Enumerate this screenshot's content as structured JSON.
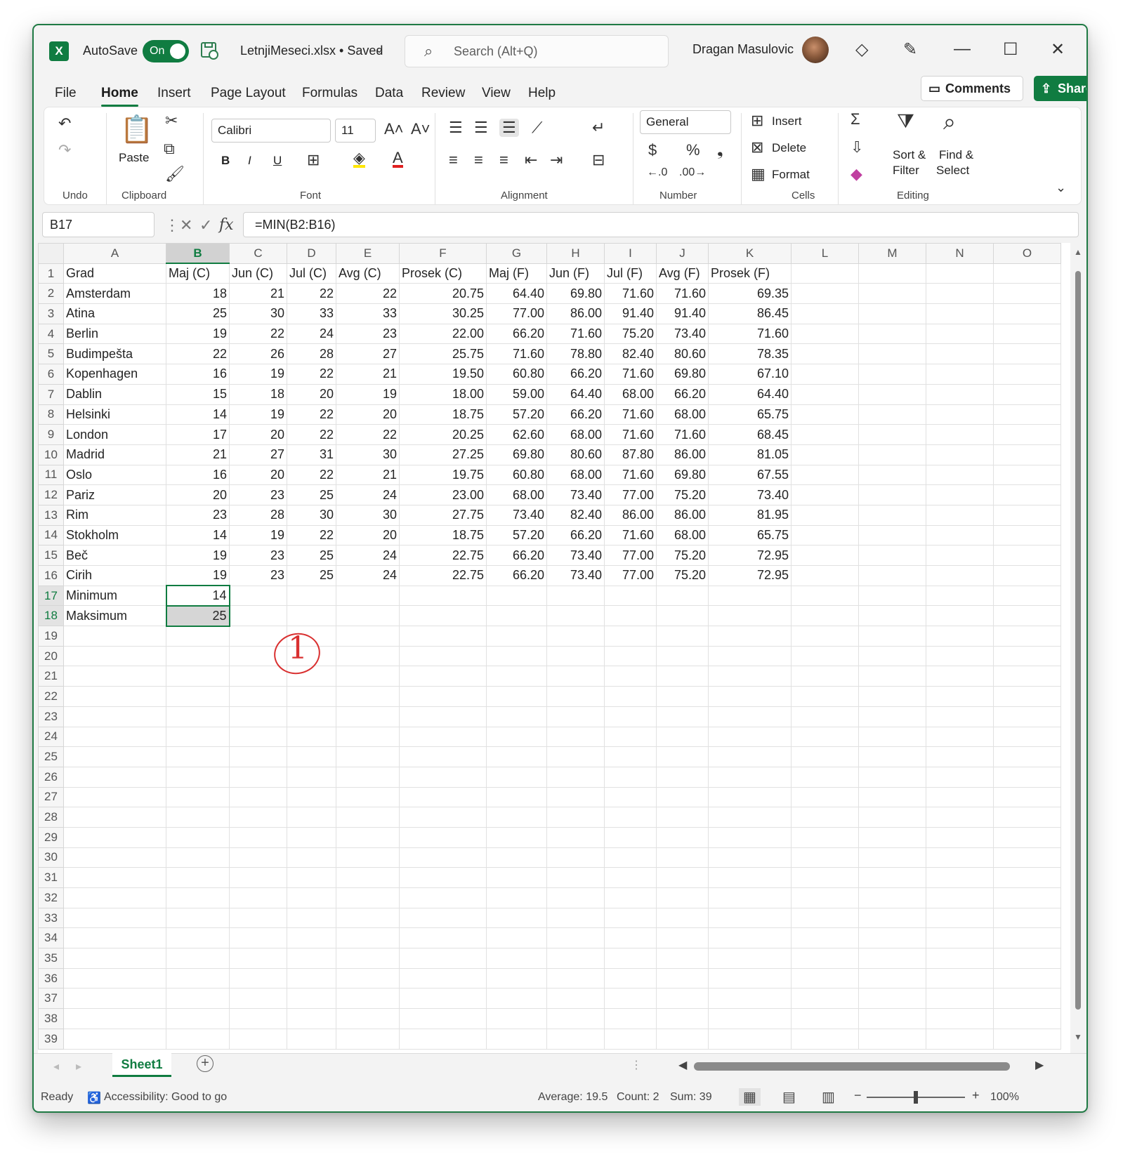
{
  "titlebar": {
    "app_logo": "X",
    "autosave_label": "AutoSave",
    "autosave_state": "On",
    "filename": "LetnjiMeseci.xlsx • Saved",
    "search_placeholder": "Search (Alt+Q)",
    "user_name": "Dragan Masulovic",
    "minimize": "—",
    "maximize": "☐",
    "close": "✕"
  },
  "menu": {
    "tabs": [
      "File",
      "Home",
      "Insert",
      "Page Layout",
      "Formulas",
      "Data",
      "Review",
      "View",
      "Help"
    ],
    "comments_label": "Comments",
    "share_label": "Share"
  },
  "ribbon": {
    "groups": {
      "undo": "Undo",
      "clipboard": "Clipboard",
      "font": "Font",
      "alignment": "Alignment",
      "number": "Number",
      "cells": "Cells",
      "editing": "Editing"
    },
    "paste_label": "Paste",
    "font_name": "Calibri",
    "font_size": "11",
    "bold": "B",
    "italic": "I",
    "underline": "U",
    "number_format": "General",
    "currency": "$",
    "percent": "%",
    "comma": "❟",
    "cells_insert": "Insert",
    "cells_delete": "Delete",
    "cells_format": "Format",
    "sort_filter": [
      "Sort &",
      "Filter"
    ],
    "find_select": [
      "Find &",
      "Select"
    ],
    "accent_colors": {
      "fill": "#ffe600",
      "font": "#e02020"
    }
  },
  "formula_bar": {
    "name_box": "B17",
    "fx": "fx",
    "formula": "=MIN(B2:B16)"
  },
  "sheet": {
    "columns": [
      "A",
      "B",
      "C",
      "D",
      "E",
      "F",
      "G",
      "H",
      "I",
      "J",
      "K",
      "L",
      "M",
      "N",
      "O"
    ],
    "selected_column": "B",
    "header_row": [
      "Grad",
      "Maj (C)",
      "Jun (C)",
      "Jul (C)",
      "Avg (C)",
      "Prosek (C)",
      "Maj (F)",
      "Jun (F)",
      "Jul (F)",
      "Avg (F)",
      "Prosek (F)"
    ],
    "rows": [
      [
        "Amsterdam",
        "18",
        "21",
        "22",
        "22",
        "20.75",
        "64.40",
        "69.80",
        "71.60",
        "71.60",
        "69.35"
      ],
      [
        "Atina",
        "25",
        "30",
        "33",
        "33",
        "30.25",
        "77.00",
        "86.00",
        "91.40",
        "91.40",
        "86.45"
      ],
      [
        "Berlin",
        "19",
        "22",
        "24",
        "23",
        "22.00",
        "66.20",
        "71.60",
        "75.20",
        "73.40",
        "71.60"
      ],
      [
        "Budimpešta",
        "22",
        "26",
        "28",
        "27",
        "25.75",
        "71.60",
        "78.80",
        "82.40",
        "80.60",
        "78.35"
      ],
      [
        "Kopenhagen",
        "16",
        "19",
        "22",
        "21",
        "19.50",
        "60.80",
        "66.20",
        "71.60",
        "69.80",
        "67.10"
      ],
      [
        "Dablin",
        "15",
        "18",
        "20",
        "19",
        "18.00",
        "59.00",
        "64.40",
        "68.00",
        "66.20",
        "64.40"
      ],
      [
        "Helsinki",
        "14",
        "19",
        "22",
        "20",
        "18.75",
        "57.20",
        "66.20",
        "71.60",
        "68.00",
        "65.75"
      ],
      [
        "London",
        "17",
        "20",
        "22",
        "22",
        "20.25",
        "62.60",
        "68.00",
        "71.60",
        "71.60",
        "68.45"
      ],
      [
        "Madrid",
        "21",
        "27",
        "31",
        "30",
        "27.25",
        "69.80",
        "80.60",
        "87.80",
        "86.00",
        "81.05"
      ],
      [
        "Oslo",
        "16",
        "20",
        "22",
        "21",
        "19.75",
        "60.80",
        "68.00",
        "71.60",
        "69.80",
        "67.55"
      ],
      [
        "Pariz",
        "20",
        "23",
        "25",
        "24",
        "23.00",
        "68.00",
        "73.40",
        "77.00",
        "75.20",
        "73.40"
      ],
      [
        "Rim",
        "23",
        "28",
        "30",
        "30",
        "27.75",
        "73.40",
        "82.40",
        "86.00",
        "86.00",
        "81.95"
      ],
      [
        "Stokholm",
        "14",
        "19",
        "22",
        "20",
        "18.75",
        "57.20",
        "66.20",
        "71.60",
        "68.00",
        "65.75"
      ],
      [
        "Beč",
        "19",
        "23",
        "25",
        "24",
        "22.75",
        "66.20",
        "73.40",
        "77.00",
        "75.20",
        "72.95"
      ],
      [
        "Cirih",
        "19",
        "23",
        "25",
        "24",
        "22.75",
        "66.20",
        "73.40",
        "77.00",
        "75.20",
        "72.95"
      ]
    ],
    "summary_rows": [
      [
        "Minimum",
        "14"
      ],
      [
        "Maksimum",
        "25"
      ]
    ],
    "total_rows_shown": 39,
    "annotation": "1"
  },
  "tabs": {
    "sheet_name": "Sheet1",
    "add_sheet": "+"
  },
  "status": {
    "ready": "Ready",
    "accessibility": "Accessibility: Good to go",
    "average": "Average: 19.5",
    "count": "Count: 2",
    "sum": "Sum: 39",
    "zoom": "100%",
    "zoom_fraction": 0.5
  }
}
